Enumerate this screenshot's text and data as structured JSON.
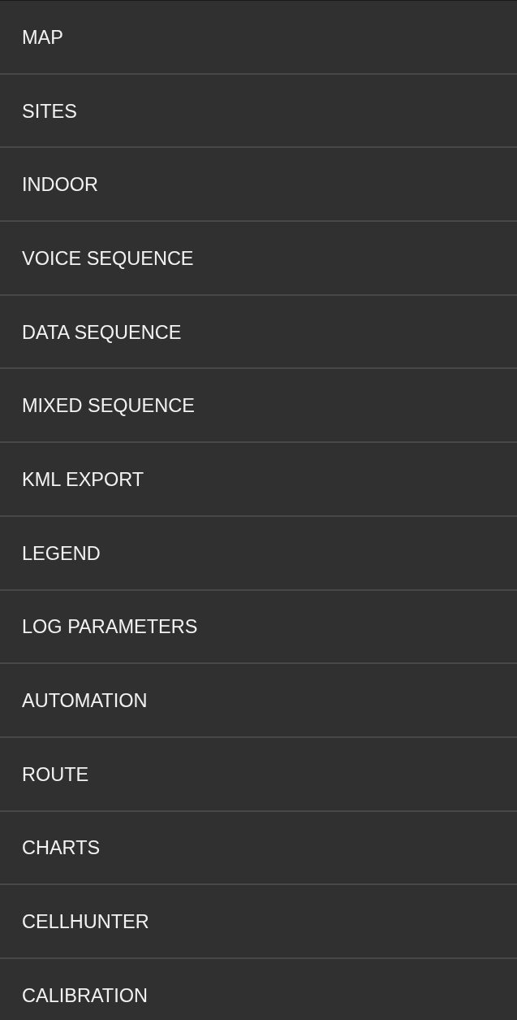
{
  "menu": {
    "items": [
      {
        "label": "MAP"
      },
      {
        "label": "SITES"
      },
      {
        "label": "INDOOR"
      },
      {
        "label": "VOICE SEQUENCE"
      },
      {
        "label": "DATA SEQUENCE"
      },
      {
        "label": "MIXED SEQUENCE"
      },
      {
        "label": "KML EXPORT"
      },
      {
        "label": "LEGEND"
      },
      {
        "label": "LOG PARAMETERS"
      },
      {
        "label": "AUTOMATION"
      },
      {
        "label": "ROUTE"
      },
      {
        "label": "CHARTS"
      },
      {
        "label": "CELLHUNTER"
      },
      {
        "label": "CALIBRATION"
      }
    ]
  }
}
